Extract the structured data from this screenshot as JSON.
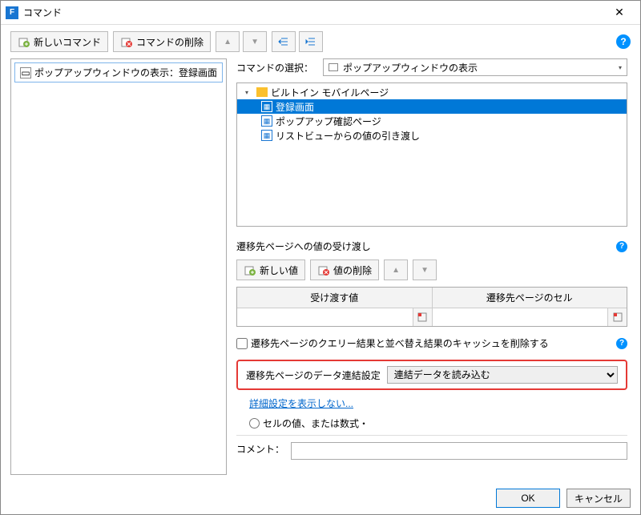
{
  "titlebar": {
    "title": "コマンド"
  },
  "toolbar": {
    "new_command": "新しいコマンド",
    "delete_command": "コマンドの削除"
  },
  "left_panel": {
    "item_label": "ポップアップウィンドウの表示：登録画面"
  },
  "right": {
    "command_select_label": "コマンドの選択：",
    "command_select_value": "ポップアップウィンドウの表示",
    "tree": {
      "folder": "ビルトイン モバイルページ",
      "items": [
        "登録画面",
        "ポップアップ確認ページ",
        "リストビューからの値の引き渡し"
      ]
    },
    "pass_value_label": "遷移先ページへの値の受け渡し",
    "new_value": "新しい値",
    "delete_value": "値の削除",
    "grid_headers": [
      "受け渡す値",
      "遷移先ページのセル"
    ],
    "checkbox_label": "遷移先ページのクエリー結果と並べ替え結果のキャッシュを削除する",
    "data_link_label": "遷移先ページのデータ連結設定",
    "data_link_value": "連結データを読み込む",
    "detail_link": "詳細設定を表示しない...",
    "radio_label": "セルの値、または数式・",
    "comment_label": "コメント："
  },
  "footer": {
    "ok": "OK",
    "cancel": "キャンセル"
  }
}
